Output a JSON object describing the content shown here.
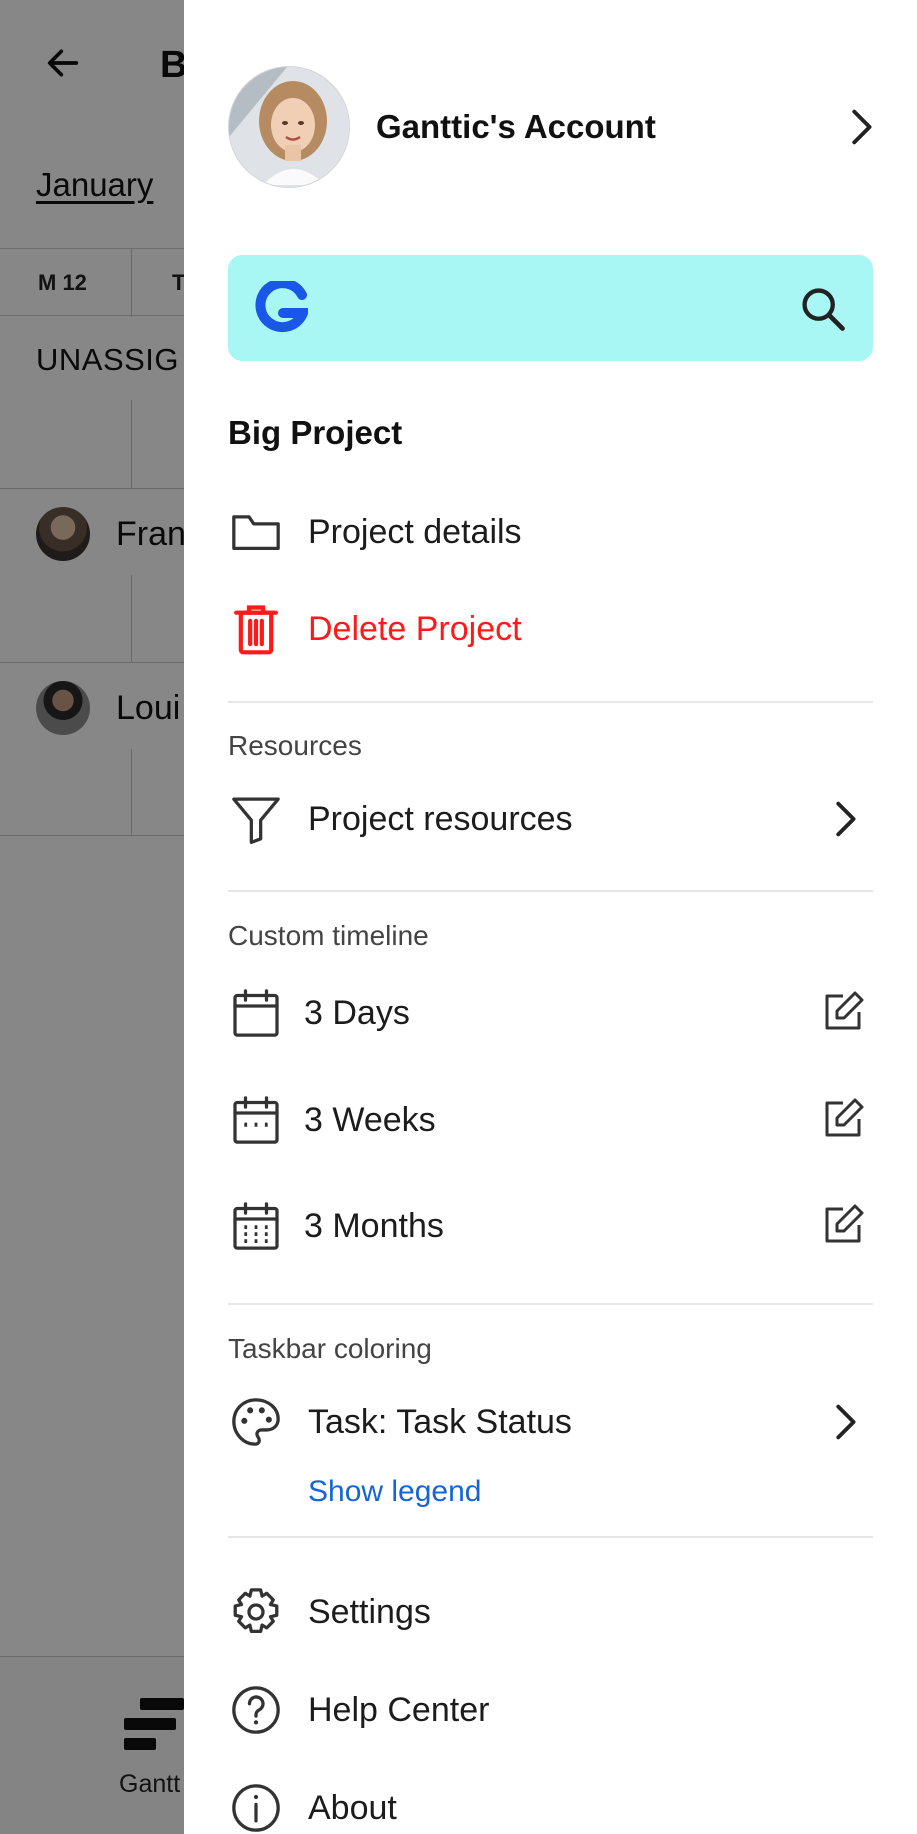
{
  "background": {
    "title": "B",
    "month": "January",
    "days": [
      "M 12",
      "T"
    ],
    "section": "UNASSIG",
    "people": [
      {
        "name": "Fran"
      },
      {
        "name": "Loui"
      }
    ],
    "bottom_nav": {
      "gantt_label": "Gantt"
    }
  },
  "drawer": {
    "account": {
      "name": "Ganttic's Account"
    },
    "search": {
      "logo": "G",
      "icon": "search-icon",
      "bg_color": "#a9f7f5"
    },
    "project": {
      "title": "Big Project",
      "details_label": "Project details",
      "delete_label": "Delete Project",
      "delete_color": "#ff1a1a"
    },
    "resources": {
      "header": "Resources",
      "item_label": "Project resources"
    },
    "custom_timeline": {
      "header": "Custom timeline",
      "items": [
        {
          "label": "3 Days",
          "icon": "calendar-icon"
        },
        {
          "label": "3 Weeks",
          "icon": "calendar-week-icon"
        },
        {
          "label": "3 Months",
          "icon": "calendar-month-icon"
        }
      ]
    },
    "taskbar_coloring": {
      "header": "Taskbar coloring",
      "item_label": "Task: Task Status",
      "legend_link": "Show legend",
      "link_color": "#1565d8"
    },
    "footer": {
      "settings_label": "Settings",
      "help_label": "Help Center",
      "about_label": "About"
    }
  }
}
